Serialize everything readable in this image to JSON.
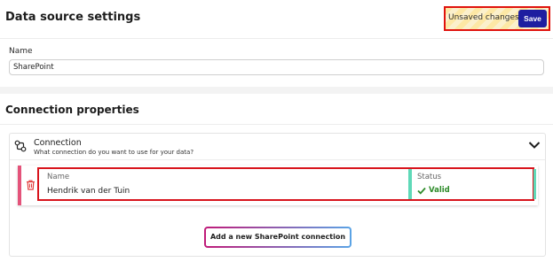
{
  "header": {
    "title": "Data source settings",
    "unsaved_text": "Unsaved changes",
    "save_label": "Save"
  },
  "name_section": {
    "label": "Name",
    "value": "SharePoint"
  },
  "connection_properties": {
    "title": "Connection properties",
    "card": {
      "title": "Connection",
      "subtitle": "What connection do you want to use for your data?",
      "icon": "plug-icon",
      "toggle_icon": "chevron-down-icon"
    },
    "connection_row": {
      "name_label": "Name",
      "name_value": "Hendrik van der Tuin",
      "status_label": "Status",
      "status_value": "Valid",
      "status_color": "#2e8b2a",
      "accent_color": "#e4537a",
      "delete_icon": "trash-icon"
    },
    "add_button_label": "Add a new SharePoint connection"
  },
  "colors": {
    "save_button": "#1e1ea0",
    "highlight_border": "#d8141c",
    "status_accent": "#5fd9b8"
  }
}
